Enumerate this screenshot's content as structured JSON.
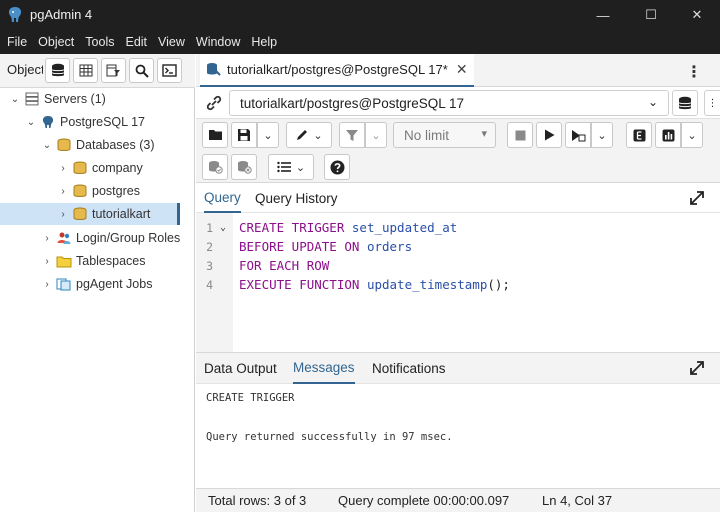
{
  "window": {
    "title": "pgAdmin 4",
    "minimize_glyph": "—",
    "maximize_glyph": "☐",
    "close_glyph": "✕"
  },
  "menu": [
    "File",
    "Object",
    "Tools",
    "Edit",
    "View",
    "Window",
    "Help"
  ],
  "object_explorer": {
    "label": "Object"
  },
  "tree": {
    "servers": "Servers (1)",
    "server": "PostgreSQL 17",
    "databases": "Databases (3)",
    "db_company": "company",
    "db_postgres": "postgres",
    "db_tutorialkart": "tutorialkart",
    "login_roles": "Login/Group Roles",
    "tablespaces": "Tablespaces",
    "pgagent": "pgAgent Jobs"
  },
  "query_tab": {
    "title": "tutorialkart/postgres@PostgreSQL 17*",
    "close_glyph": "✕"
  },
  "connection": {
    "value": "tutorialkart/postgres@PostgreSQL 17"
  },
  "toolbar": {
    "limit_value": "No limit"
  },
  "editor_tabs": {
    "query": "Query",
    "history": "Query History"
  },
  "code_lines": [
    {
      "num": "1",
      "kw": "CREATE TRIGGER ",
      "ident": "set_updated_at",
      "rest": ""
    },
    {
      "num": "2",
      "kw": "BEFORE UPDATE ON ",
      "ident": "orders",
      "rest": ""
    },
    {
      "num": "3",
      "kw": "FOR EACH ROW",
      "ident": "",
      "rest": ""
    },
    {
      "num": "4",
      "kw": "EXECUTE FUNCTION ",
      "ident": "update_timestamp",
      "rest": "();"
    }
  ],
  "result_tabs": {
    "data_output": "Data Output",
    "messages": "Messages",
    "notifications": "Notifications"
  },
  "messages": {
    "line1": "CREATE TRIGGER",
    "line2": "Query returned successfully in 97 msec."
  },
  "status": {
    "total_rows": "Total rows: 3 of 3",
    "query_complete": "Query complete 00:00:00.097",
    "cursor": "Ln 4, Col 37"
  },
  "colors": {
    "accent": "#326690",
    "keyword": "#8c0f8c",
    "identifier": "#2a4fa8",
    "titlebar": "#1f1f1f"
  }
}
